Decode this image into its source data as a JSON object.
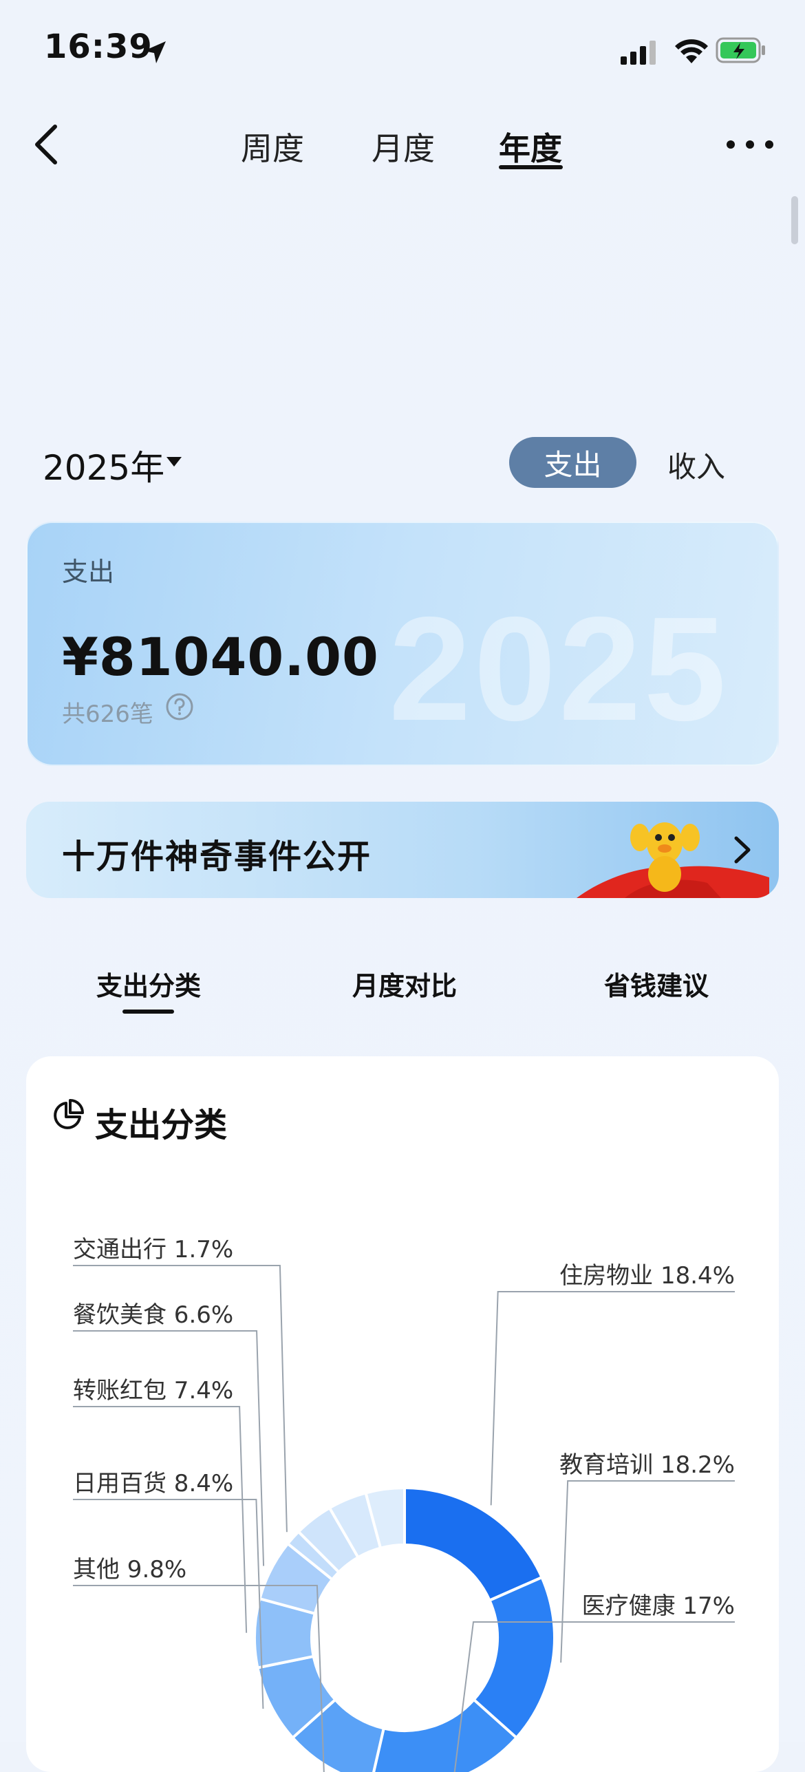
{
  "status_bar": {
    "time": "16:39"
  },
  "nav": {
    "tabs": [
      "周度",
      "月度",
      "年度"
    ],
    "active_tab": "年度"
  },
  "year_selector": {
    "value": "2025年"
  },
  "type_toggle": {
    "expense": "支出",
    "income": "收入",
    "active": "支出"
  },
  "summary": {
    "label": "支出",
    "amount": "¥81040.00",
    "count": "共626笔",
    "background_year": "2025"
  },
  "banner": {
    "text": "十万件神奇事件公开"
  },
  "section_tabs": [
    "支出分类",
    "月度对比",
    "省钱建议"
  ],
  "chart_card": {
    "title": "支出分类"
  },
  "chart_data": {
    "type": "pie",
    "title": "支出分类",
    "categories": [
      "住房物业",
      "教育培训",
      "医疗健康",
      "其他",
      "日用百货",
      "转账红包",
      "餐饮美食",
      "交通出行"
    ],
    "values": [
      18.4,
      18.2,
      17,
      9.8,
      8.4,
      7.4,
      6.6,
      1.7
    ],
    "labels": [
      "住房物业 18.4%",
      "教育培训 18.2%",
      "医疗健康 17%",
      "其他 9.8%",
      "日用百货 8.4%",
      "转账红包 7.4%",
      "餐饮美食 6.6%",
      "交通出行 1.7%"
    ],
    "colors": [
      "#1a6ff0",
      "#2a80f5",
      "#3c8ff6",
      "#5aa2f7",
      "#74b1f8",
      "#8ec0f9",
      "#a9cefa",
      "#c2ddfb",
      "#cfe4fb",
      "#d7e9fc",
      "#deedfc"
    ]
  }
}
